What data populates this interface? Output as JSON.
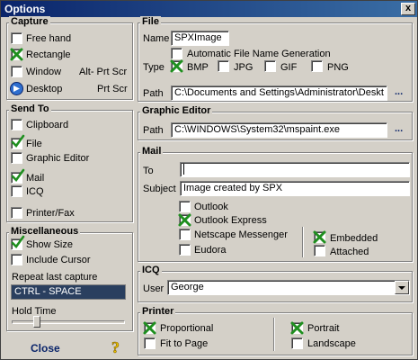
{
  "window": {
    "title": "Options",
    "close_glyph": "x"
  },
  "capture": {
    "title": "Capture",
    "free_hand": {
      "label": "Free hand",
      "checked": false
    },
    "rectangle": {
      "label": "Rectangle",
      "checked": true
    },
    "window_opt": {
      "label": "Window",
      "checked": false
    },
    "desktop": {
      "label": "Desktop"
    },
    "window_hotkey": "Alt- Prt Scr",
    "desktop_hotkey": "Prt Scr"
  },
  "send_to": {
    "title": "Send To",
    "clipboard": {
      "label": "Clipboard",
      "checked": false
    },
    "file": {
      "label": "File",
      "checked": true
    },
    "graphic_editor": {
      "label": "Graphic Editor",
      "checked": false
    },
    "mail": {
      "label": "Mail",
      "checked": true
    },
    "icq": {
      "label": "ICQ",
      "checked": false
    },
    "printer_fax": {
      "label": "Printer/Fax",
      "checked": false
    }
  },
  "misc": {
    "title": "Miscellaneous",
    "show_size": {
      "label": "Show Size",
      "checked": true
    },
    "include_cursor": {
      "label": "Include Cursor",
      "checked": false
    },
    "repeat_label": "Repeat last capture",
    "repeat_hotkey": "CTRL - SPACE",
    "hold_time_label": "Hold Time",
    "hold_time_fraction": 0.2
  },
  "bottom": {
    "close_label": "Close",
    "help_glyph": "?"
  },
  "file": {
    "title": "File",
    "name_label": "Name",
    "name_value": "SPXImage",
    "auto_name": {
      "label": "Automatic File Name Generation",
      "checked": false
    },
    "type_label": "Type",
    "types": [
      {
        "label": "BMP",
        "checked": true
      },
      {
        "label": "JPG",
        "checked": false
      },
      {
        "label": "GIF",
        "checked": false
      },
      {
        "label": "PNG",
        "checked": false
      }
    ],
    "path_label": "Path",
    "path_value": "C:\\Documents and Settings\\Administrator\\Deskt",
    "browse": "..."
  },
  "graphic_editor": {
    "title": "Graphic Editor",
    "path_label": "Path",
    "path_value": "C:\\WINDOWS\\System32\\mspaint.exe",
    "browse": "..."
  },
  "mail": {
    "title": "Mail",
    "to_label": "To",
    "to_value": "",
    "subject_label": "Subject",
    "subject_value": "Image created by SPX",
    "clients": [
      {
        "label": "Outlook",
        "checked": false
      },
      {
        "label": "Outlook Express",
        "checked": true
      },
      {
        "label": "Netscape Messenger",
        "checked": false
      },
      {
        "label": "Eudora",
        "checked": false
      }
    ],
    "embedded": {
      "label": "Embedded",
      "checked": true
    },
    "attached": {
      "label": "Attached",
      "checked": false
    }
  },
  "icq": {
    "title": "ICQ",
    "user_label": "User",
    "user_value": "George"
  },
  "printer": {
    "title": "Printer",
    "proportional": {
      "label": "Proportional",
      "checked": true
    },
    "fit_to_page": {
      "label": "Fit to Page",
      "checked": false
    },
    "portrait": {
      "label": "Portrait",
      "checked": true
    },
    "landscape": {
      "label": "Landscape",
      "checked": false
    }
  },
  "colors": {
    "title_bar": "#0a246a",
    "check_green": "#1f8f1f",
    "repeat_box": "#2a3f5f"
  }
}
